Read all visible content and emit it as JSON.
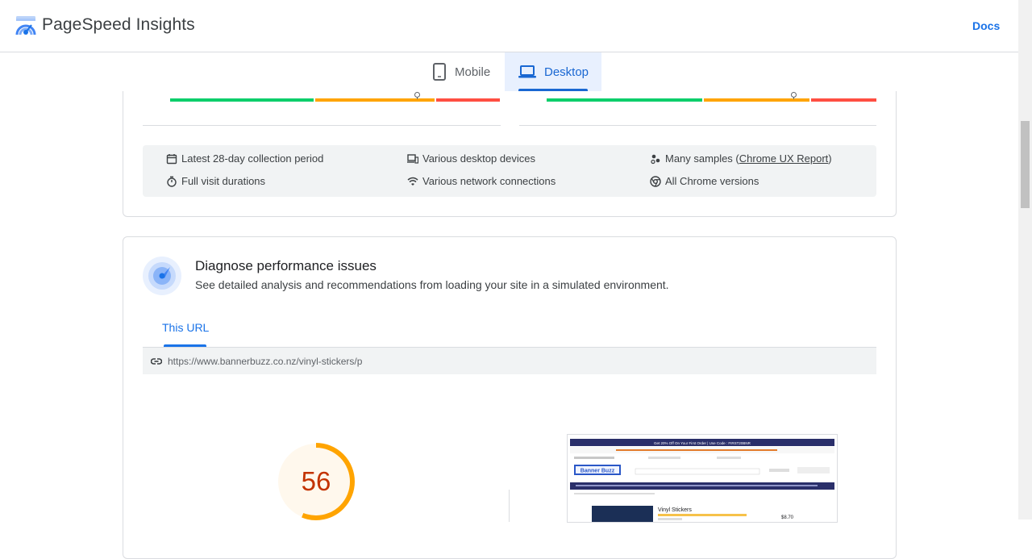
{
  "header": {
    "app_title": "PageSpeed Insights",
    "docs_label": "Docs",
    "logo_icon": "pagespeed-logo"
  },
  "tabs": [
    {
      "label": "Mobile",
      "icon": "phone-icon",
      "selected": false
    },
    {
      "label": "Desktop",
      "icon": "laptop-icon",
      "selected": true
    }
  ],
  "field_data": {
    "info": {
      "collection_period": "Latest 28-day collection period",
      "devices": "Various desktop devices",
      "samples_prefix": "Many samples (",
      "samples_link": "Chrome UX Report",
      "samples_suffix": ")",
      "durations": "Full visit durations",
      "network": "Various network connections",
      "versions": "All Chrome versions"
    }
  },
  "diagnose": {
    "title": "Diagnose performance issues",
    "subtitle": "See detailed analysis and recommendations from loading your site in a simulated environment.",
    "tab_label": "This URL",
    "url": "https://www.bannerbuzz.co.nz/vinyl-stickers/p",
    "performance_score": "56",
    "score_fraction": 0.56,
    "screenshot": {
      "promo": "Get 20% Off On Your First Order | Use Code : FIRST20BNR",
      "brand": "Banner Buzz",
      "product": "Vinyl Stickers",
      "price": "$8.70"
    }
  },
  "colors": {
    "good": "#0cce6b",
    "average": "#ffa400",
    "poor": "#ff4e42",
    "accent": "#1a73e8"
  }
}
